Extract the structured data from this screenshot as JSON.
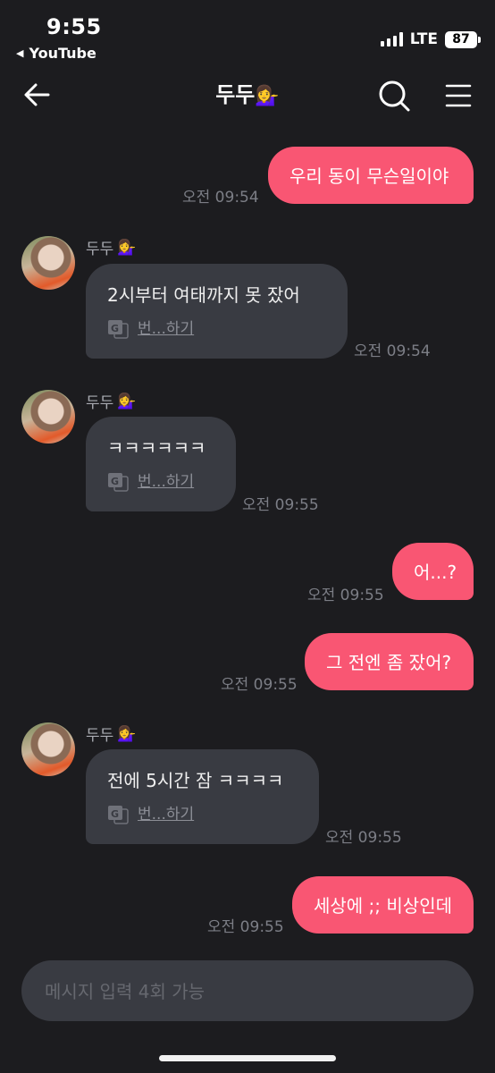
{
  "status_bar": {
    "time": "9:55",
    "back_app": "YouTube",
    "network": "LTE",
    "battery": "87"
  },
  "header": {
    "title": "두두",
    "title_emoji": "💁‍♀️"
  },
  "translate_label": "번...하기",
  "messages": [
    {
      "from": "me",
      "text": "우리 동이 무슨일이야",
      "time": "오전 09:54"
    },
    {
      "from": "them",
      "sender": "두두",
      "sender_emoji": "💁‍♀️",
      "text": "2시부터  여태까지 못 잤어",
      "time": "오전 09:54"
    },
    {
      "from": "them",
      "sender": "두두",
      "sender_emoji": "💁‍♀️",
      "text": "ㅋㅋㅋㅋㅋㅋ",
      "time": "오전 09:55"
    },
    {
      "from": "me",
      "text": "어...?",
      "time": "오전 09:55"
    },
    {
      "from": "me",
      "text": "그 전엔 좀 잤어?",
      "time": "오전 09:55"
    },
    {
      "from": "them",
      "sender": "두두",
      "sender_emoji": "💁‍♀️",
      "text": "전에 5시간 잠 ㅋㅋㅋㅋ",
      "time": "오전 09:55"
    },
    {
      "from": "me",
      "text": "세상에 ;; 비상인데",
      "time": "오전 09:55"
    }
  ],
  "input": {
    "placeholder": "메시지 입력 4회 가능",
    "value": ""
  },
  "colors": {
    "background": "#1c1c1f",
    "my_bubble": "#f95673",
    "their_bubble": "#393b42"
  }
}
